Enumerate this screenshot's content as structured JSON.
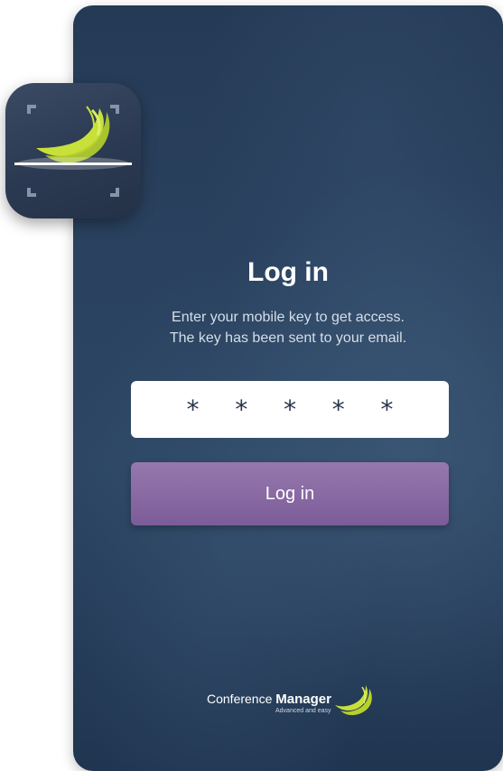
{
  "app_icon": {
    "name": "app-icon"
  },
  "login": {
    "title": "Log in",
    "subtitle_line1": "Enter your mobile key to get access.",
    "subtitle_line2": "The key has been sent to your email.",
    "key_value": "* * * * *",
    "button_label": "Log in"
  },
  "brand": {
    "name_light": "Conference",
    "name_bold": "Manager",
    "tagline": "Advanced and easy"
  },
  "colors": {
    "background": "#2a4260",
    "button": "#8a6aa3",
    "accent": "#c8e03a"
  }
}
